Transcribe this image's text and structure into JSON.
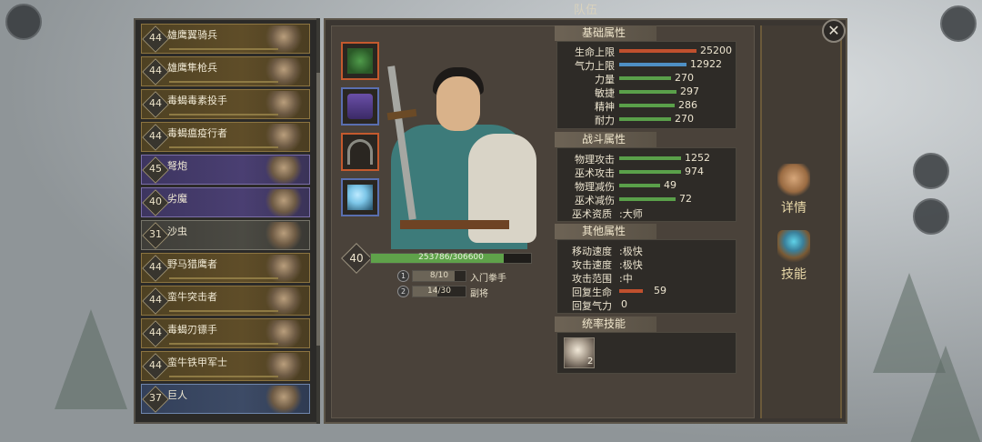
{
  "window": {
    "title": "队伍",
    "close_symbol": "✕"
  },
  "roster": [
    {
      "level": "44",
      "name": "雄鹰翼骑兵",
      "style": "gold"
    },
    {
      "level": "44",
      "name": "雄鹰隼枪兵",
      "style": "gold"
    },
    {
      "level": "44",
      "name": "毒蝎毒素投手",
      "style": "gold"
    },
    {
      "level": "44",
      "name": "毒蝎瘟疫行者",
      "style": "gold"
    },
    {
      "level": "45",
      "name": "弩炮",
      "style": "purple"
    },
    {
      "level": "40",
      "name": "劣魔",
      "style": "purple"
    },
    {
      "level": "31",
      "name": "沙虫",
      "style": "grey"
    },
    {
      "level": "44",
      "name": "野马猎鹰者",
      "style": "gold"
    },
    {
      "level": "44",
      "name": "蛮牛突击者",
      "style": "gold"
    },
    {
      "level": "44",
      "name": "毒蝎刃镖手",
      "style": "gold"
    },
    {
      "level": "44",
      "name": "蛮牛铁甲军士",
      "style": "gold"
    },
    {
      "level": "37",
      "name": "巨人",
      "style": "blue"
    }
  ],
  "equipment": [
    {
      "icon": "jade-pendant-icon",
      "color": "#4f9b4a"
    },
    {
      "icon": "purple-robe-icon",
      "color": "#6a4fa8"
    },
    {
      "icon": "bow-icon",
      "color": "#8a8a82"
    },
    {
      "icon": "spirit-horse-icon",
      "color": "#7cc6e8"
    }
  ],
  "hero": {
    "level": "40",
    "xp_text": "253786/306600",
    "xp_fraction": 0.828,
    "traits": [
      {
        "badge": "1",
        "progress_text": "8/10",
        "progress_fraction": 0.8,
        "name": "入门拳手"
      },
      {
        "badge": "2",
        "progress_text": "14/30",
        "progress_fraction": 0.467,
        "name": "副将"
      }
    ]
  },
  "sections": {
    "base": {
      "title": "基础属性",
      "rows": [
        {
          "label": "生命上限",
          "value": "25200",
          "fill": 0.99,
          "color": "#c0502e"
        },
        {
          "label": "气力上限",
          "value": "12922",
          "fill": 0.86,
          "color": "#4e8fc4"
        },
        {
          "label": "力量",
          "value": "270",
          "fill": 0.66,
          "color": "#5aa04a"
        },
        {
          "label": "敏捷",
          "value": "297",
          "fill": 0.73,
          "color": "#5aa04a"
        },
        {
          "label": "精神",
          "value": "286",
          "fill": 0.71,
          "color": "#5aa04a"
        },
        {
          "label": "耐力",
          "value": "270",
          "fill": 0.66,
          "color": "#5aa04a"
        }
      ]
    },
    "combat": {
      "title": "战斗属性",
      "rows": [
        {
          "label": "物理攻击",
          "value": "1252",
          "fill": 0.79,
          "color": "#5aa04a"
        },
        {
          "label": "巫术攻击",
          "value": "974",
          "fill": 0.79,
          "color": "#5aa04a"
        },
        {
          "label": "物理减伤",
          "value": "49",
          "fill": 0.52,
          "color": "#5aa04a"
        },
        {
          "label": "巫术减伤",
          "value": "72",
          "fill": 0.72,
          "color": "#5aa04a"
        }
      ],
      "aptitude_label": "巫术资质",
      "aptitude_value": "大师"
    },
    "other": {
      "title": "其他属性",
      "rows": [
        {
          "label": "移动速度",
          "value": "极快"
        },
        {
          "label": "攻击速度",
          "value": "极快"
        },
        {
          "label": "攻击范围",
          "value": "中"
        }
      ],
      "regen_hp_label": "回复生命",
      "regen_hp_value": "59",
      "regen_hp_fill": 0.3,
      "regen_hp_color": "#c0502e",
      "regen_sp_label": "回复气力",
      "regen_sp_value": "0"
    },
    "command": {
      "title": "统率技能",
      "skill_level": "2"
    }
  },
  "side_buttons": {
    "details": "详情",
    "skills": "技能"
  }
}
